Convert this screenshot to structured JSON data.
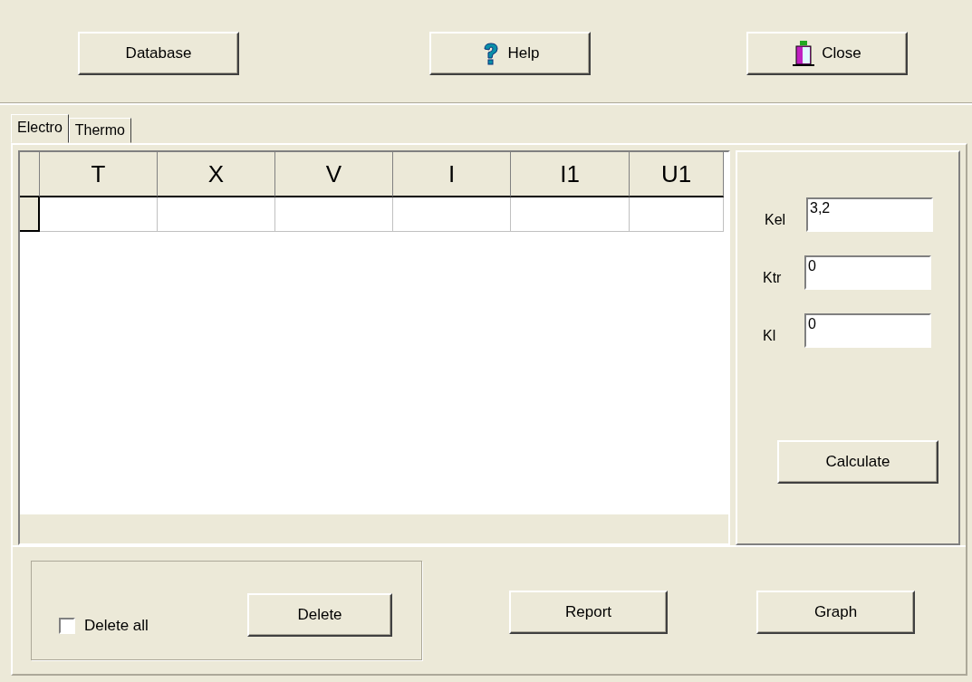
{
  "toolbar": {
    "buttons": [
      {
        "label": "Database",
        "kind": "plain"
      },
      {
        "label": "Help",
        "kind": "help"
      },
      {
        "label": "Close",
        "kind": "close"
      }
    ]
  },
  "tabs": [
    {
      "label": "Electro",
      "selected": true
    },
    {
      "label": "Thermo",
      "selected": false
    }
  ],
  "table": {
    "columns": [
      "T",
      "X",
      "V",
      "I",
      "I1",
      "U1"
    ]
  },
  "coefficients": [
    {
      "label": "Kel",
      "value": "3,2"
    },
    {
      "label": "Ktr",
      "value": "0"
    },
    {
      "label": "Kl",
      "value": "0"
    }
  ],
  "calculate_button": "Calculate",
  "delete_all": {
    "label": "Delete all",
    "checked": false
  },
  "delete_button": "Delete",
  "bottom_buttons": [
    "Report",
    "Graph"
  ]
}
